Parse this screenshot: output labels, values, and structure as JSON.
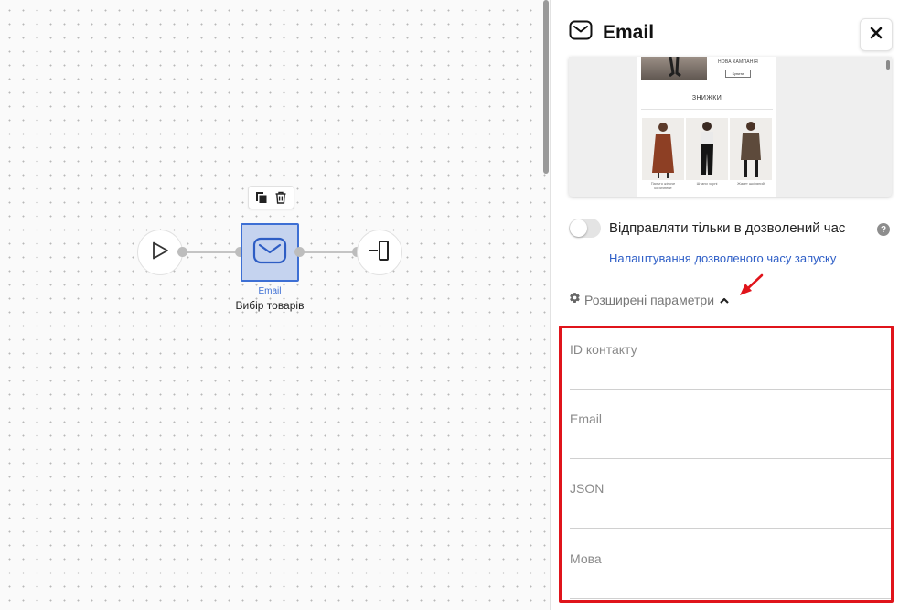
{
  "canvas": {
    "toolbar": {
      "copy_icon": "copy-icon",
      "delete_icon": "trash-icon"
    },
    "nodes": {
      "start": {
        "icon": "play-icon"
      },
      "email": {
        "icon": "mail-icon",
        "type_label": "Email",
        "name": "Вибір товарів",
        "fill": "#c5d3ef",
        "border": "#3d6fd4"
      },
      "end": {
        "icon": "exit-icon"
      }
    }
  },
  "panel": {
    "title": "Email",
    "title_icon": "mail-icon",
    "close_icon": "close-icon",
    "preview": {
      "campaign_text": "НОВА КАМПАНІЯ",
      "button_text": "Купити",
      "heading": "ЗНИЖКИ",
      "products": [
        {
          "caption": "Пальто жіноче коричневе"
        },
        {
          "caption": "Штани чорні"
        },
        {
          "caption": "Жакет шкіряний"
        }
      ]
    },
    "allowed_time": {
      "label": "Відправляти тільки в дозволений час",
      "enabled": false,
      "help_icon": "help-icon",
      "help_glyph": "?",
      "link": "Налаштування дозволеного часу запуску"
    },
    "advanced": {
      "label": "Розширені параметри",
      "icon": "gear-icon",
      "expanded": true
    },
    "fields": [
      {
        "label": "ID контакту"
      },
      {
        "label": "Email"
      },
      {
        "label": "JSON"
      },
      {
        "label": "Мова"
      }
    ],
    "highlight_color": "#e0141b",
    "link_color": "#2f5fc7"
  }
}
